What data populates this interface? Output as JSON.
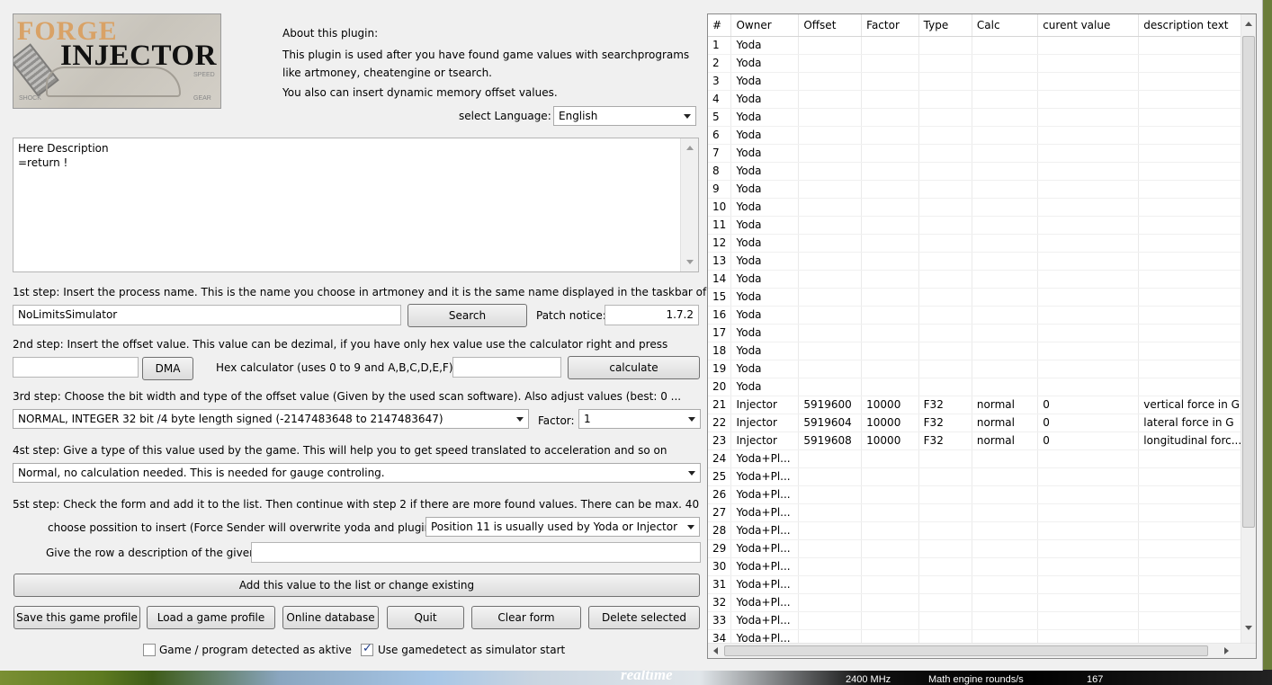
{
  "about": {
    "heading": "About this plugin:",
    "line1": "This plugin is used after you have found game values with searchprograms",
    "line2": "like artmoney, cheatengine or tsearch.",
    "line3": "You also can insert dynamic memory offset values."
  },
  "logo": {
    "word1": "FORGE",
    "word2": "INJECTOR",
    "tag_shock": "SHOCK",
    "tag_speed": "SPEED",
    "tag_gear": "GEAR"
  },
  "language": {
    "label": "select Language:",
    "value": "English"
  },
  "description": {
    "text": "Here Description\n=return !"
  },
  "step1": {
    "text": "1st step: Insert the process name. This is the name you choose in artmoney and it is the same name displayed in the taskbar of",
    "process_value": "NoLimitsSimulator",
    "search_label": "Search",
    "patch_label": "Patch notice:",
    "patch_value": "1.7.2"
  },
  "step2": {
    "text": "2nd step: Insert the offset value. This value can be dezimal, if you have only hex value use the calculator right and press",
    "offset_value": "",
    "dma_label": "DMA",
    "hex_label": "Hex calculator (uses 0 to 9 and A,B,C,D,E,F)",
    "hex_value": "",
    "calculate_label": "calculate"
  },
  "step3": {
    "text": "3rd step: Choose the bit width and type of the offset value (Given by the used scan software). Also adjust values (best: 0 ...",
    "type_value": "NORMAL, INTEGER 32 bit /4 byte length signed (-2147483648 to 2147483647)",
    "factor_label": "Factor:",
    "factor_value": "1"
  },
  "step4": {
    "text": "4st step: Give a type of this value used by the game. This will help you to get speed translated to acceleration and so on",
    "calc_value": "Normal, no calculation needed. This is needed for gauge controling."
  },
  "step5": {
    "text": "5st step: Check the form and add it to the list. Then continue with step 2 if there are more found values. There can be max. 40",
    "position_label": "choose possition to insert (Force Sender will overwrite yoda and plugin",
    "position_value": "Position 11 is usually used by Yoda or Injector",
    "desc_label": "Give the row a description of the given",
    "desc_value": "",
    "add_label": "Add this value to the list or change existing"
  },
  "buttons": {
    "save": "Save this game profile",
    "load": "Load a game profile",
    "online": "Online database",
    "quit": "Quit",
    "clear": "Clear form",
    "delete": "Delete selected"
  },
  "checks": {
    "detected_label": "Game / program detected as aktive",
    "detected_checked": false,
    "gamedetect_label": "Use gamedetect as simulator start",
    "gamedetect_checked": true
  },
  "grid": {
    "columns": [
      "#",
      "Owner",
      "Offset",
      "Factor",
      "Type",
      "Calc",
      "curent value",
      "description text"
    ],
    "rows": [
      [
        "1",
        "Yoda",
        "",
        "",
        "",
        "",
        "",
        ""
      ],
      [
        "2",
        "Yoda",
        "",
        "",
        "",
        "",
        "",
        ""
      ],
      [
        "3",
        "Yoda",
        "",
        "",
        "",
        "",
        "",
        ""
      ],
      [
        "4",
        "Yoda",
        "",
        "",
        "",
        "",
        "",
        ""
      ],
      [
        "5",
        "Yoda",
        "",
        "",
        "",
        "",
        "",
        ""
      ],
      [
        "6",
        "Yoda",
        "",
        "",
        "",
        "",
        "",
        ""
      ],
      [
        "7",
        "Yoda",
        "",
        "",
        "",
        "",
        "",
        ""
      ],
      [
        "8",
        "Yoda",
        "",
        "",
        "",
        "",
        "",
        ""
      ],
      [
        "9",
        "Yoda",
        "",
        "",
        "",
        "",
        "",
        ""
      ],
      [
        "10",
        "Yoda",
        "",
        "",
        "",
        "",
        "",
        ""
      ],
      [
        "11",
        "Yoda",
        "",
        "",
        "",
        "",
        "",
        ""
      ],
      [
        "12",
        "Yoda",
        "",
        "",
        "",
        "",
        "",
        ""
      ],
      [
        "13",
        "Yoda",
        "",
        "",
        "",
        "",
        "",
        ""
      ],
      [
        "14",
        "Yoda",
        "",
        "",
        "",
        "",
        "",
        ""
      ],
      [
        "15",
        "Yoda",
        "",
        "",
        "",
        "",
        "",
        ""
      ],
      [
        "16",
        "Yoda",
        "",
        "",
        "",
        "",
        "",
        ""
      ],
      [
        "17",
        "Yoda",
        "",
        "",
        "",
        "",
        "",
        ""
      ],
      [
        "18",
        "Yoda",
        "",
        "",
        "",
        "",
        "",
        ""
      ],
      [
        "19",
        "Yoda",
        "",
        "",
        "",
        "",
        "",
        ""
      ],
      [
        "20",
        "Yoda",
        "",
        "",
        "",
        "",
        "",
        ""
      ],
      [
        "21",
        "Injector",
        "5919600",
        "10000",
        "F32",
        "normal",
        "0",
        "vertical force in G"
      ],
      [
        "22",
        "Injector",
        "5919604",
        "10000",
        "F32",
        "normal",
        "0",
        "lateral force in G"
      ],
      [
        "23",
        "Injector",
        "5919608",
        "10000",
        "F32",
        "normal",
        "0",
        "longitudinal forc..."
      ],
      [
        "24",
        "Yoda+Pl...",
        "",
        "",
        "",
        "",
        "",
        ""
      ],
      [
        "25",
        "Yoda+Pl...",
        "",
        "",
        "",
        "",
        "",
        ""
      ],
      [
        "26",
        "Yoda+Pl...",
        "",
        "",
        "",
        "",
        "",
        ""
      ],
      [
        "27",
        "Yoda+Pl...",
        "",
        "",
        "",
        "",
        "",
        ""
      ],
      [
        "28",
        "Yoda+Pl...",
        "",
        "",
        "",
        "",
        "",
        ""
      ],
      [
        "29",
        "Yoda+Pl...",
        "",
        "",
        "",
        "",
        "",
        ""
      ],
      [
        "30",
        "Yoda+Pl...",
        "",
        "",
        "",
        "",
        "",
        ""
      ],
      [
        "31",
        "Yoda+Pl...",
        "",
        "",
        "",
        "",
        "",
        ""
      ],
      [
        "32",
        "Yoda+Pl...",
        "",
        "",
        "",
        "",
        "",
        ""
      ],
      [
        "33",
        "Yoda+Pl...",
        "",
        "",
        "",
        "",
        "",
        ""
      ],
      [
        "34",
        "Yoda+Pl...",
        "",
        "",
        "",
        "",
        "",
        ""
      ]
    ]
  },
  "desktop": {
    "realtime": "realtime",
    "mhz": "2400 MHz",
    "math": "Math engine rounds/s",
    "count": "167"
  }
}
